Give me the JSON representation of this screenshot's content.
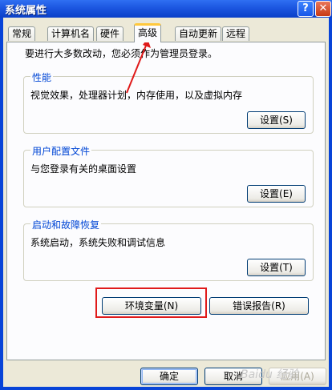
{
  "window": {
    "title": "系统属性",
    "help_glyph": "?",
    "close_glyph": "✕"
  },
  "tabs": [
    {
      "label": "常规"
    },
    {
      "label": "计算机名"
    },
    {
      "label": "硬件"
    },
    {
      "label": "高级",
      "active": true
    },
    {
      "label": "自动更新"
    },
    {
      "label": "远程"
    }
  ],
  "notice": "要进行大多数改动，您必须作为管理员登录。",
  "groups": {
    "performance": {
      "title": "性能",
      "description": "视觉效果，处理器计划，内存使用，以及虚拟内存",
      "button": "设置(S)"
    },
    "profiles": {
      "title": "用户配置文件",
      "description": "与您登录有关的桌面设置",
      "button": "设置(E)"
    },
    "startup": {
      "title": "启动和故障恢复",
      "description": "系统启动，系统失败和调试信息",
      "button": "设置(T)"
    }
  },
  "actions": {
    "env_vars": "环境变量(N)",
    "error_report": "错误报告(R)"
  },
  "footer": {
    "ok": "确定",
    "cancel": "取消",
    "apply": "应用(A)"
  },
  "watermark": "Baidu 经验",
  "colors": {
    "accent_highlight": "#e01a1a",
    "group_title": "#0046d5",
    "active_tab_top": "#ffc83c"
  }
}
